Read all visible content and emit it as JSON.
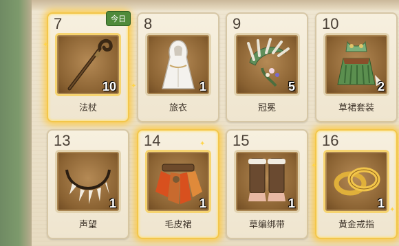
{
  "rewards": [
    {
      "day": "7",
      "name": "法杖",
      "count": "10",
      "badge": "今日",
      "icon": "staff-icon"
    },
    {
      "day": "8",
      "name": "旅衣",
      "count": "1",
      "icon": "travel-robe-icon"
    },
    {
      "day": "9",
      "name": "冠冕",
      "count": "5",
      "icon": "feather-crown-icon"
    },
    {
      "day": "10",
      "name": "草裙套装",
      "count": "2",
      "icon": "grass-skirt-outfit-icon"
    },
    {
      "day": "13",
      "name": "声望",
      "count": "1",
      "icon": "tooth-necklace-icon"
    },
    {
      "day": "14",
      "name": "毛皮裙",
      "count": "1",
      "icon": "fur-skirt-icon"
    },
    {
      "day": "15",
      "name": "草编绑带",
      "count": "1",
      "icon": "straw-leg-wraps-icon"
    },
    {
      "day": "16",
      "name": "黄金戒指",
      "count": "1",
      "icon": "gold-rings-icon"
    }
  ],
  "colors": {
    "glow": "#f3c64a",
    "badge": "#4f8a3a",
    "frame": "#8a6232"
  }
}
